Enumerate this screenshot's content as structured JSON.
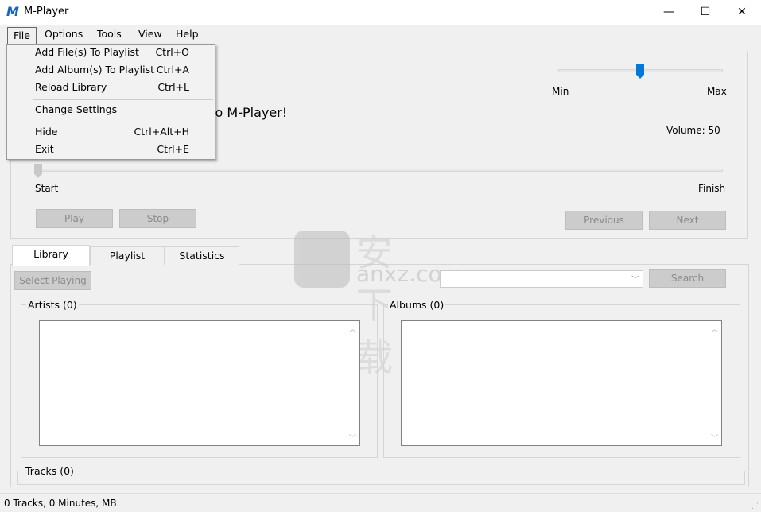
{
  "window": {
    "title": "M-Player",
    "controls": [
      "—",
      "☐",
      "✕"
    ]
  },
  "menubar": [
    "File",
    "Options",
    "Tools",
    "View",
    "Help"
  ],
  "file_menu": {
    "items": [
      {
        "label": "Add File(s) To Playlist",
        "shortcut": "Ctrl+O"
      },
      {
        "label": "Add Album(s) To Playlist",
        "shortcut": "Ctrl+A"
      },
      {
        "label": "Reload Library",
        "shortcut": "Ctrl+L"
      },
      {
        "label": "Change Settings",
        "shortcut": ""
      },
      {
        "label": "Hide",
        "shortcut": "Ctrl+Alt+H"
      },
      {
        "label": "Exit",
        "shortcut": "Ctrl+E"
      }
    ]
  },
  "player": {
    "welcome": "Welcome to M-Player!",
    "volume_min": "Min",
    "volume_max": "Max",
    "volume_label": "Volume: 50",
    "volume_value": 50,
    "progress_start": "Start",
    "progress_finish": "Finish",
    "progress_value": 0,
    "buttons": {
      "play": "Play",
      "stop": "Stop",
      "previous": "Previous",
      "next": "Next"
    }
  },
  "tabs": {
    "items": [
      "Library",
      "Playlist",
      "Statistics"
    ],
    "selected": "Library"
  },
  "library": {
    "select_playing": "Select Playing",
    "search_value": "",
    "search_button": "Search",
    "artists_label": "Artists (0)",
    "albums_label": "Albums (0)",
    "tracks_label": "Tracks (0)"
  },
  "status": "0 Tracks, 0 Minutes,  MB",
  "watermark": {
    "cn": "安下载",
    "domain": "anxz.com"
  },
  "colors": {
    "accent": "#0078d7"
  }
}
